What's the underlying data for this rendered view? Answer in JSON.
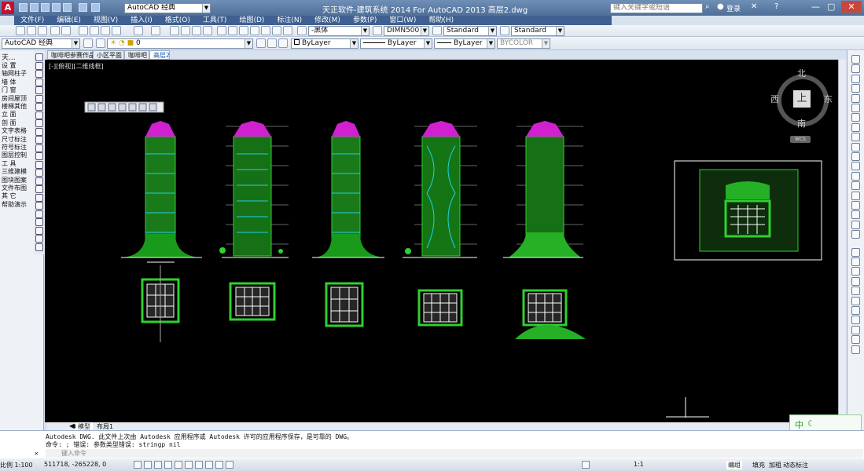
{
  "window": {
    "title": "天正软件-建筑系统 2014  For AutoCAD 2013      高层2.dwg"
  },
  "search": {
    "placeholder": "键入关键字或短语"
  },
  "user": {
    "login_label": "登录"
  },
  "menu": [
    "文件(F)",
    "编辑(E)",
    "视图(V)",
    "插入(I)",
    "格式(O)",
    "工具(T)",
    "绘图(D)",
    "标注(N)",
    "修改(M)",
    "参数(P)",
    "窗口(W)",
    "帮助(H)"
  ],
  "toolbar": {
    "workspace": "AutoCAD 经典",
    "workspace2": "AutoCAD 经典",
    "layer_value": "0",
    "textstyle": "-黑体",
    "dimstyle": "DIMN500",
    "tablestyle": "Standard",
    "mleaderstyle": "Standard",
    "layer_color": "ByLayer",
    "linetype": "ByLayer",
    "lineweight": "ByLayer",
    "plotstyle": "BYCOLOR"
  },
  "left_panel": {
    "header": "天...",
    "items": [
      "设  置",
      "轴网柱子",
      "墙  体",
      "门  窗",
      "房间屋顶",
      "楼梯其他",
      "立  面",
      "剖  面",
      "文字表格",
      "尺寸标注",
      "符号标注",
      "图层控制",
      "工  具",
      "三维建模",
      "图块图案",
      "文件布图",
      "其  它",
      "帮助演示"
    ]
  },
  "doc_tabs": [
    "咖啡吧参赛作品",
    "小区平面",
    "咖啡吧",
    "高层2"
  ],
  "viewport": {
    "label": "[-][俯视][二维线框]"
  },
  "viewcube": {
    "north": "北",
    "south": "南",
    "east": "东",
    "west": "西",
    "top": "上",
    "wcs": "WCS"
  },
  "layout_tabs": [
    "模型",
    "布局1"
  ],
  "command": {
    "line1": "Autodesk DWG.   此文件上次由 Autodesk 应用程序或 Autodesk 许可的应用程序保存，是可靠的 DWG。",
    "line2": "命令: ; 错误: 参数类型错误: stringp nil",
    "prompt": "键入命令"
  },
  "status": {
    "scale": "比例 1:100",
    "coords": "511718, -265228, 0",
    "anno_scale": "1:1",
    "buttons": [
      "编组",
      "填充",
      "加粗",
      "动态标注"
    ]
  },
  "ime": {
    "label": "中"
  },
  "colors": {
    "canvas": "#000000",
    "green": "#1fbf1f",
    "magenta": "#e020e0",
    "cyan": "#20d0e0",
    "white": "#ffffff"
  }
}
